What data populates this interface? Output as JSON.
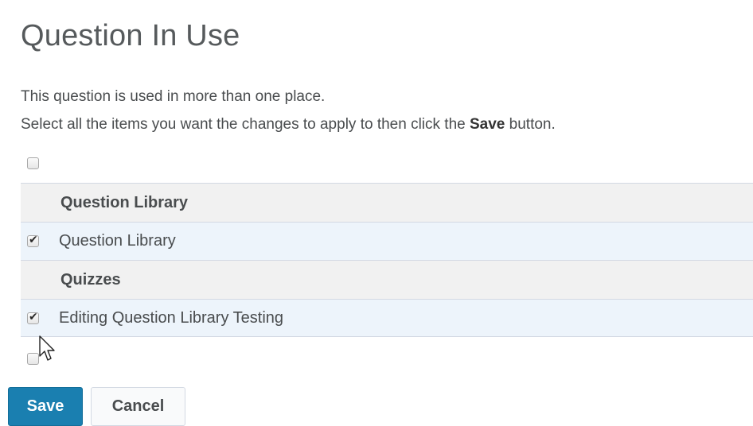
{
  "dialog": {
    "title": "Question In Use",
    "description_line1": "This question is used in more than one place.",
    "description_line2_before": "Select all the items you want the changes to apply to then click the ",
    "description_line2_bold": "Save",
    "description_line2_after": " button."
  },
  "select_all_top": {
    "checked": false
  },
  "groups": [
    {
      "label": "Question Library",
      "items": [
        {
          "label": "Question Library",
          "checked": true
        }
      ]
    },
    {
      "label": "Quizzes",
      "items": [
        {
          "label": "Editing Question Library Testing",
          "checked": true
        }
      ]
    }
  ],
  "select_all_bottom": {
    "checked": false
  },
  "buttons": {
    "save": "Save",
    "cancel": "Cancel"
  },
  "colors": {
    "primary": "#1a7fb0",
    "row_highlight": "#edf4fb",
    "group_header": "#f1f1f1"
  },
  "cursor": {
    "icon": "mouse-pointer-icon"
  }
}
